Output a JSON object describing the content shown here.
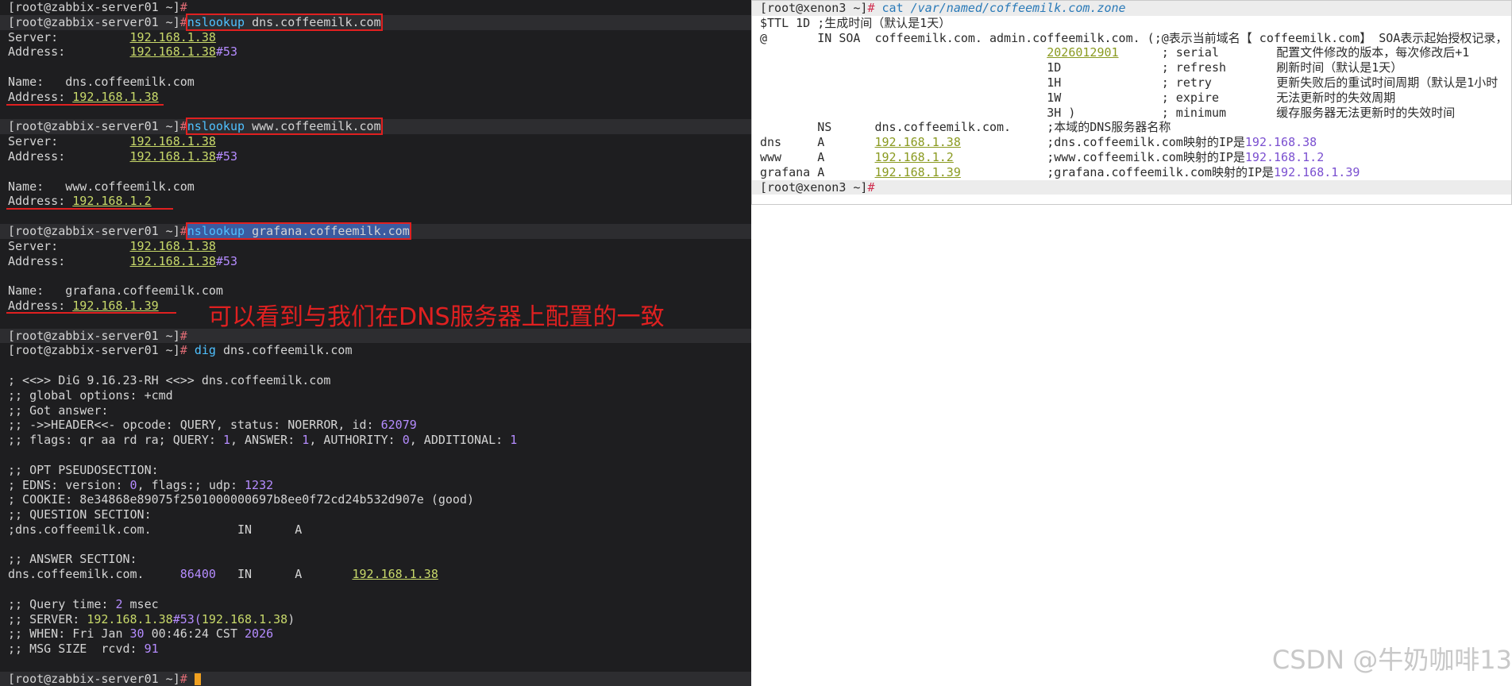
{
  "left": {
    "prompt": "[root@zabbix-server01 ~]",
    "hash": "#",
    "lookups": [
      {
        "cmd": "nslookup",
        "arg": "dns.coffeemilk.com",
        "server_label": "Server:",
        "server": "192.168.1.38",
        "address_label": "Address:",
        "address_ip": "192.168.1.38",
        "address_port": "#53",
        "name_label": "Name:",
        "name": "dns.coffeemilk.com",
        "result_label": "Address:",
        "result": "192.168.1.38"
      },
      {
        "cmd": "nslookup",
        "arg": "www.coffeemilk.com",
        "server_label": "Server:",
        "server": "192.168.1.38",
        "address_label": "Address:",
        "address_ip": "192.168.1.38",
        "address_port": "#53",
        "name_label": "Name:",
        "name": "www.coffeemilk.com",
        "result_label": "Address:",
        "result": "192.168.1.2"
      },
      {
        "cmd": "nslookup",
        "arg": "grafana.coffeemilk.com",
        "server_label": "Server:",
        "server": "192.168.1.38",
        "address_label": "Address:",
        "address_ip": "192.168.1.38",
        "address_port": "#53",
        "name_label": "Name:",
        "name": "grafana.coffeemilk.com",
        "result_label": "Address:",
        "result": "192.168.1.39"
      }
    ],
    "note": "可以看到与我们在DNS服务器上配置的一致",
    "dig_cmd": "dig",
    "dig_arg": "dns.coffeemilk.com",
    "dig": {
      "l1a": "; <<>> DiG 9.16.23-RH <<>> dns.coffeemilk.com",
      "l2a": ";; global options: +cmd",
      "l3a": ";; Got answer:",
      "l4a": ";; ->>HEADER<<- opcode: QUERY, status: NOERROR, id: ",
      "l4id": "62079",
      "l5a": ";; flags: qr aa rd ra; QUERY: ",
      "l5q": "1",
      "l5b": ", ANSWER: ",
      "l5an": "1",
      "l5c": ", AUTHORITY: ",
      "l5au": "0",
      "l5d": ", ADDITIONAL: ",
      "l5ad": "1",
      "l6": ";; OPT PSEUDOSECTION:",
      "l7a": "; EDNS: version: ",
      "l7v": "0",
      "l7b": ", flags:; udp: ",
      "l7u": "1232",
      "l8": "; COOKIE: 8e34868e89075f2501000000697b8ee0f72cd24b532d907e (good)",
      "l9": ";; QUESTION SECTION:",
      "l10": ";dns.coffeemilk.com.            IN      A",
      "l11": ";; ANSWER SECTION:",
      "l12a": "dns.coffeemilk.com.     ",
      "l12ttl": "86400",
      "l12b": "   IN      A       ",
      "l12ip": "192.168.1.38",
      "l13a": ";; Query time: ",
      "l13n": "2",
      "l13b": " msec",
      "l14a": ";; SERVER: ",
      "l14ip": "192.168.1.38",
      "l14b": "#53(",
      "l14ip2": "192.168.1.38",
      "l14c": ")",
      "l15a": ";; WHEN: Fri Jan ",
      "l15d": "30",
      "l15b": " 00:46:24 CST ",
      "l15y": "2026",
      "l16a": ";; MSG SIZE  rcvd: ",
      "l16n": "91"
    }
  },
  "right": {
    "prompt": "[root@xenon3 ~]",
    "hash": "#",
    "cmd": "cat",
    "path": "/var/named/coffeemilk.com.zone",
    "r1": "$TTL 1D ;生成时间（默认是1天）",
    "r2": "@       IN SOA  coffeemilk.com. admin.coffeemilk.com. (;@表示当前域名【 coffeemilk.com】 SOA表示起始授权记录，",
    "serial": "2026012901",
    "r3b": "      ; serial        配置文件修改的版本，每次修改后+1",
    "r4": "                                        1D              ; refresh       刷新时间（默认是1天）",
    "r5": "                                        1H              ; retry         更新失败后的重试时间周期（默认是1小时",
    "r6": "                                        1W              ; expire        无法更新时的失效周期",
    "r7": "                                        3H )            ; minimum       缓存服务器无法更新时的失效时间",
    "r8": "        NS      dns.coffeemilk.com.     ;本域的DNS服务器名称",
    "records": [
      {
        "host": "dns     A       ",
        "ip": "192.168.1.38",
        "pad": "            ",
        "cm": ";dns.coffeemilk.com映射的IP是",
        "cmip": "192.168.38"
      },
      {
        "host": "www     A       ",
        "ip": "192.168.1.2",
        "pad": "             ",
        "cm": ";www.coffeemilk.com映射的IP是",
        "cmip": "192.168.1.2"
      },
      {
        "host": "grafana A       ",
        "ip": "192.168.1.39",
        "pad": "            ",
        "cm": ";grafana.coffeemilk.com映射的IP是",
        "cmip": "192.168.1.39"
      }
    ]
  },
  "watermark": "CSDN @牛奶咖啡13"
}
